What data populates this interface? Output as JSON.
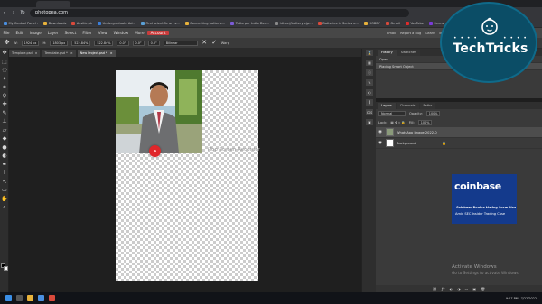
{
  "browser": {
    "url": "photopea.com",
    "bookmarks": [
      {
        "label": "My Control Panel -",
        "color": "#4a8fe0"
      },
      {
        "label": "Downloads",
        "color": "#e8b23b"
      },
      {
        "label": "Acsitic.pk",
        "color": "#d94a3b"
      },
      {
        "label": "Undergraduate Ad...",
        "color": "#3b7ed9"
      },
      {
        "label": "Find scientific art s...",
        "color": "#5aa0d6"
      },
      {
        "label": "Connecting batterie...",
        "color": "#e8b23b"
      },
      {
        "label": "Tutto per tutto Dev...",
        "color": "#7b5bd6"
      },
      {
        "label": "https://batteryu.jp...",
        "color": "#8a8a8a"
      },
      {
        "label": "Batteries in Series a...",
        "color": "#d94a3b"
      },
      {
        "label": "HOBBY",
        "color": "#e8b23b"
      },
      {
        "label": "Gmail",
        "color": "#d94a3b"
      },
      {
        "label": "YouTube",
        "color": "#e02b2b"
      },
      {
        "label": "Forms",
        "color": "#7b3bd9"
      }
    ]
  },
  "menu": {
    "items": [
      "File",
      "Edit",
      "Image",
      "Layer",
      "Select",
      "Filter",
      "View",
      "Window",
      "More",
      "Account"
    ],
    "active": "Account",
    "right": [
      "Email",
      "Report a bug",
      "Learn",
      "Blog",
      "API"
    ]
  },
  "options": {
    "w_label": "W:",
    "w_value": "1924 px",
    "h_label": "H:",
    "h_value": "1803 px",
    "w_pct": "522.84%",
    "h_pct": "522.84%",
    "x_value": "0.0°",
    "skew_x": "0.0°",
    "skew_y": "0.0°",
    "interp": "Bilinear",
    "warp": "Warp"
  },
  "doc_tabs": [
    {
      "label": "Template.psd",
      "active": false
    },
    {
      "label": "Template.psd *",
      "active": false
    },
    {
      "label": "New Project.psd *",
      "active": true
    }
  ],
  "canvas": {
    "watermark": "iTop Screen Recorder"
  },
  "history": {
    "tabs": [
      "History",
      "Swatches"
    ],
    "rows": [
      "Open",
      "Placing Smart Object"
    ]
  },
  "layers": {
    "tabs": [
      "Layers",
      "Channels",
      "Paths"
    ],
    "blend": "Normal",
    "opacity_label": "Opacity:",
    "opacity": "100%",
    "lock_label": "Lock:",
    "fill_label": "Fill:",
    "fill": "100%",
    "items": [
      {
        "name": "WhatsApp Image 2022-0",
        "selected": true
      },
      {
        "name": "Background",
        "selected": false
      }
    ]
  },
  "ad": {
    "title": "coinbase",
    "caption1": "Coinbase Denies Listing Securities",
    "caption2": "Amid SEC Insider Trading Case"
  },
  "activate": {
    "line1": "Activate Windows",
    "line2": "Go to Settings to activate Windows."
  },
  "badge": {
    "text": "TechTricks"
  },
  "taskbar": {
    "time": "9:17 PM",
    "date": "7/22/2022"
  }
}
